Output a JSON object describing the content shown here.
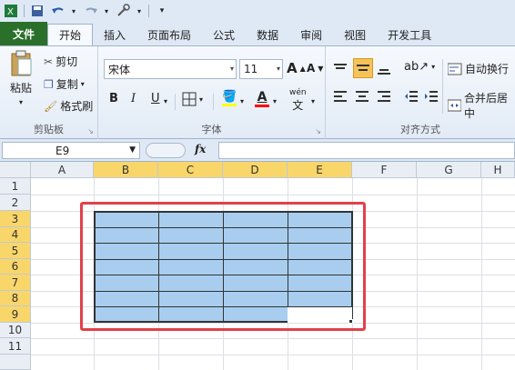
{
  "qat": {
    "save_icon": "save-icon",
    "undo_icon": "undo-icon",
    "redo_icon": "redo-icon",
    "tools_icon": "tools-icon",
    "customize": "▾"
  },
  "tabs": [
    {
      "label": "文件"
    },
    {
      "label": "开始"
    },
    {
      "label": "插入"
    },
    {
      "label": "页面布局"
    },
    {
      "label": "公式"
    },
    {
      "label": "数据"
    },
    {
      "label": "审阅"
    },
    {
      "label": "视图"
    },
    {
      "label": "开发工具"
    }
  ],
  "clipboard": {
    "paste_label": "粘贴",
    "cut_label": "剪切",
    "copy_label": "复制",
    "format_painter_label": "格式刷",
    "group_label": "剪贴板"
  },
  "font": {
    "font_name": "宋体",
    "font_size": "11",
    "bold": "B",
    "italic": "I",
    "underline": "U",
    "font_color_letter": "A",
    "grow": "A",
    "shrink": "A",
    "wen": "wén",
    "group_label": "字体"
  },
  "alignment": {
    "wrap_label": "自动换行",
    "merge_label": "合并后居中",
    "group_label": "对齐方式"
  },
  "formula_bar": {
    "name_box": "E9",
    "fx": "fx",
    "value": ""
  },
  "columns": [
    "A",
    "B",
    "C",
    "D",
    "E",
    "F",
    "G",
    "H"
  ],
  "rows": [
    "1",
    "2",
    "3",
    "4",
    "5",
    "6",
    "7",
    "8",
    "9",
    "10",
    "11"
  ],
  "colors": {
    "selection_fill": "#a9cdee",
    "header_selected": "#f8d66a",
    "highlight_border": "#e2414a",
    "file_tab": "#2a6f2a"
  },
  "selection": {
    "range": "B3:E9",
    "active_cell": "E9"
  }
}
